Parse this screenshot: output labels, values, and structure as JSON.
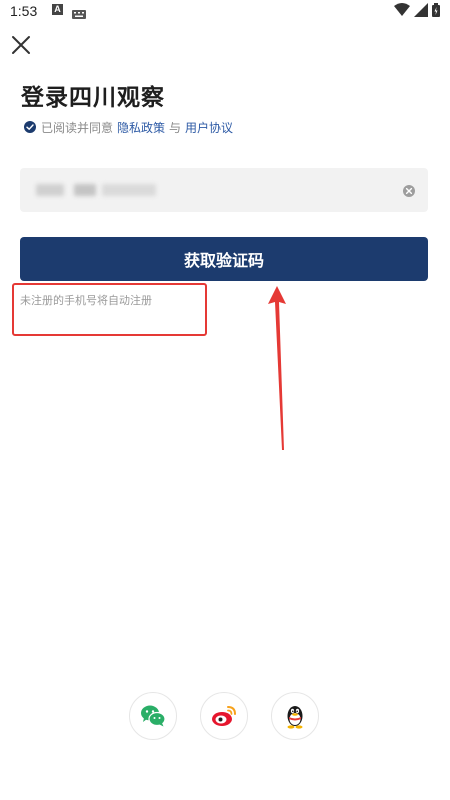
{
  "status_bar": {
    "time": "1:53",
    "notif_icons": [
      "a-icon",
      "keyboard-icon"
    ],
    "right_icons": [
      "wifi-icon",
      "signal-icon",
      "battery-icon"
    ]
  },
  "header": {
    "close_icon": "close-icon"
  },
  "title": "登录四川观察",
  "agreement": {
    "prefix": "已阅读并同意",
    "privacy_link": "隐私政策",
    "separator": "与",
    "terms_link": "用户协议",
    "checked": true
  },
  "phone_input": {
    "value": "",
    "placeholder": "",
    "masked": true
  },
  "get_code_button": {
    "label": "获取验证码"
  },
  "hint": "未注册的手机号将自动注册",
  "social_login": [
    {
      "name": "wechat",
      "icon": "wechat-icon"
    },
    {
      "name": "weibo",
      "icon": "weibo-icon"
    },
    {
      "name": "qq",
      "icon": "qq-icon"
    }
  ],
  "colors": {
    "primary": "#1c3b6e",
    "link": "#2d5aa5",
    "annotation": "#e53935",
    "field_bg": "#f2f2f2"
  }
}
